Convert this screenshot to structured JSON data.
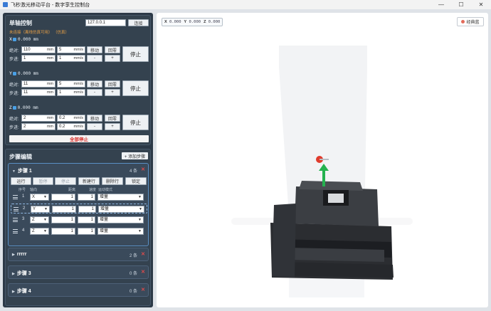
{
  "window": {
    "title": "飞秒激光移动平台 - 数字孪生控制台"
  },
  "axis_panel": {
    "title": "单轴控制",
    "ip_value": "127.0.0.1",
    "connect_label": "连接",
    "status_note": "未连接（离线仿真可用） （仿真）",
    "axes": [
      {
        "name": "X",
        "position": "0.000 mm",
        "abs_label": "绝对:",
        "step_label": "步进:",
        "abs_value": "110",
        "abs_unit": "mm",
        "abs_speed": "5",
        "abs_speed_unit": "mm/s",
        "step_value": "1",
        "step_unit": "mm",
        "step_speed": "1",
        "step_speed_unit": "mm/s",
        "move_label": "移动",
        "home_label": "回零",
        "minus_label": "-",
        "plus_label": "+",
        "stop_label": "停止"
      },
      {
        "name": "Y",
        "position": "0.000 mm",
        "abs_label": "绝对:",
        "step_label": "步进:",
        "abs_value": "11",
        "abs_unit": "mm",
        "abs_speed": "5",
        "abs_speed_unit": "mm/s",
        "step_value": "11",
        "step_unit": "mm",
        "step_speed": "1",
        "step_speed_unit": "mm/s",
        "move_label": "移动",
        "home_label": "回零",
        "minus_label": "-",
        "plus_label": "+",
        "stop_label": "停止"
      },
      {
        "name": "Z",
        "position": "0.000 mm",
        "abs_label": "绝对:",
        "step_label": "步进:",
        "abs_value": "2",
        "abs_unit": "mm",
        "abs_speed": "0.2",
        "abs_speed_unit": "mm/s",
        "step_value": "2",
        "step_unit": "mm",
        "step_speed": "0.2",
        "step_speed_unit": "mm/s",
        "move_label": "移动",
        "home_label": "回零",
        "minus_label": "-",
        "plus_label": "+",
        "stop_label": "停止"
      }
    ],
    "all_stop_label": "全部停止"
  },
  "step_panel": {
    "title": "步骤编辑",
    "add_step_label": "+ 添加步骤",
    "expanded_step": {
      "name": "步骤 1",
      "count": "4 条",
      "actions": [
        "运行",
        "暂停",
        "停止",
        "新建行",
        "删除行",
        "锁定"
      ],
      "columns": [
        "序号",
        "轴向",
        "距离",
        "速度",
        "运动模式"
      ],
      "rows": [
        {
          "index": "1",
          "axis": "X",
          "distance": "1",
          "speed": "1",
          "mode": "增量"
        },
        {
          "index": "2",
          "axis": "Y",
          "distance": "1",
          "speed": "1",
          "mode": "增量"
        },
        {
          "index": "3",
          "axis": "Z",
          "distance": "1",
          "speed": "1",
          "mode": "增量"
        },
        {
          "index": "4",
          "axis": "Z",
          "distance": "1",
          "speed": "1",
          "mode": "增量"
        }
      ]
    },
    "collapsed_steps": [
      {
        "name": "rrrrr",
        "count": "2 条"
      },
      {
        "name": "步骤 3",
        "count": "0 条"
      },
      {
        "name": "步骤 4",
        "count": "0 条"
      }
    ]
  },
  "viewport": {
    "coords": {
      "x_label": "X",
      "x_value": "0.000",
      "y_label": "Y",
      "y_value": "0.000",
      "z_label": "Z",
      "z_value": "0.000"
    },
    "classic_label": "经典蓝"
  },
  "colors": {
    "panel_bg": "#2c3947",
    "accent_blue": "#4aa0e6",
    "danger": "#d9302c",
    "warning_text": "#e9a045"
  }
}
